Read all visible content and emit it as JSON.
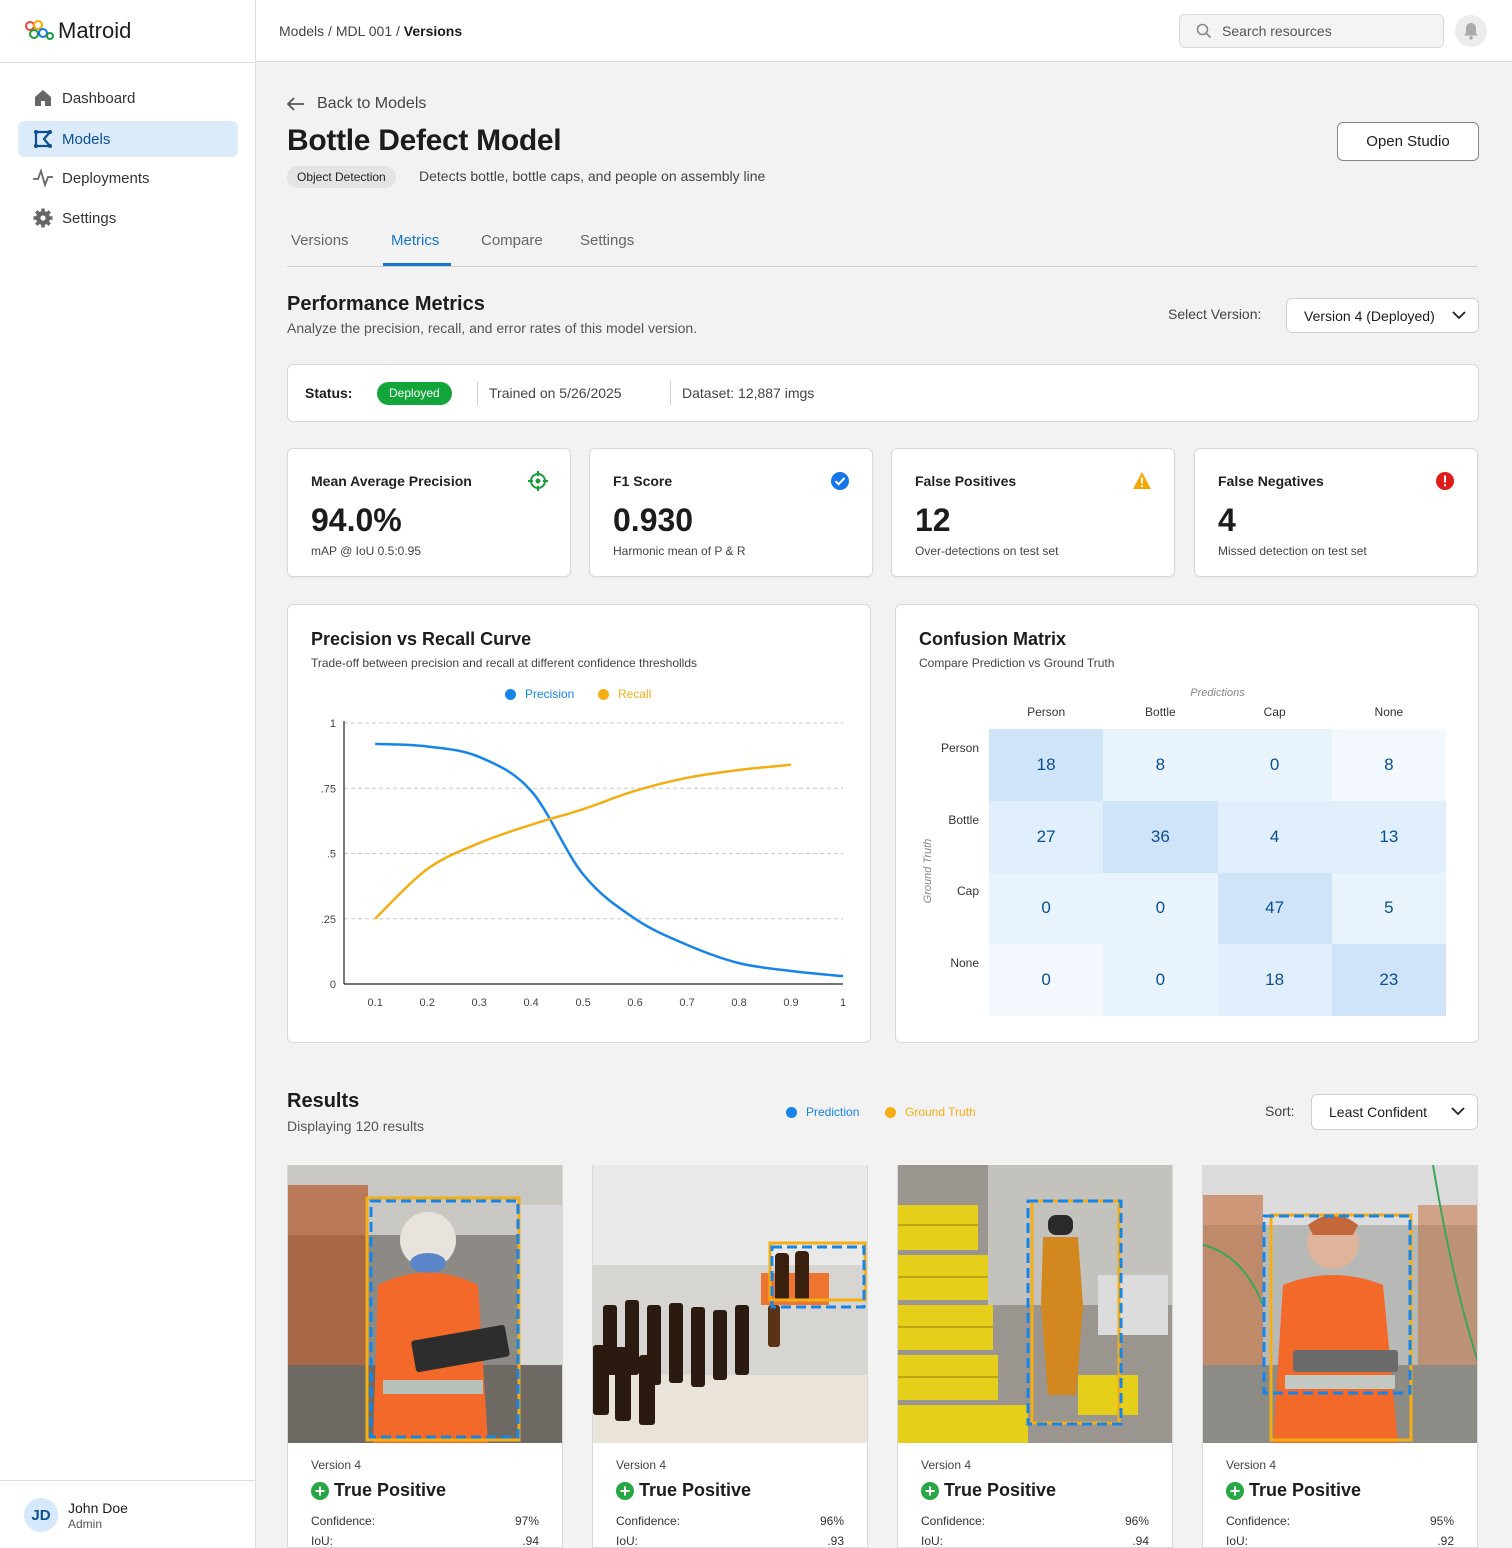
{
  "app": {
    "name": "Matroid"
  },
  "sidebar": {
    "items": [
      {
        "label": "Dashboard",
        "icon": "home-icon"
      },
      {
        "label": "Models",
        "icon": "models-icon",
        "active": true
      },
      {
        "label": "Deployments",
        "icon": "pulse-icon"
      },
      {
        "label": "Settings",
        "icon": "gear-icon"
      }
    ],
    "user": {
      "initials": "JD",
      "name": "John Doe",
      "role": "Admin"
    }
  },
  "header": {
    "breadcrumb": [
      "Models",
      "MDL 001",
      "Versions"
    ],
    "search_placeholder": "Search resources"
  },
  "page": {
    "back_label": "Back to Models",
    "title": "Bottle Defect Model",
    "type_chip": "Object Detection",
    "description": "Detects bottle, bottle caps, and people on assembly line",
    "open_studio_label": "Open Studio",
    "tabs": [
      "Versions",
      "Metrics",
      "Compare",
      "Settings"
    ],
    "active_tab": "Metrics"
  },
  "metrics": {
    "title": "Performance Metrics",
    "subtitle": "Analyze the precision, recall, and error rates of this model version.",
    "select_label": "Select Version:",
    "select_value": "Version 4 (Deployed)",
    "status_label": "Status:",
    "status_value": "Deployed",
    "trained": "Trained on 5/26/2025",
    "dataset": "Dataset: 12,887 imgs",
    "cards": [
      {
        "title": "Mean Average Precision",
        "value": "94.0%",
        "sub": "mAP @ IoU 0.5:0.95",
        "icon": "target-icon",
        "color": "#1a9e3c"
      },
      {
        "title": "F1 Score",
        "value": "0.930",
        "sub": "Harmonic mean of P & R",
        "icon": "check-circle-icon",
        "color": "#1677e8"
      },
      {
        "title": "False Positives",
        "value": "12",
        "sub": "Over-detections on test set",
        "icon": "warning-icon",
        "color": "#f5a800"
      },
      {
        "title": "False Negatives",
        "value": "4",
        "sub": "Missed detection on test set",
        "icon": "error-icon",
        "color": "#e01b1b"
      }
    ]
  },
  "pr_curve": {
    "title": "Precision vs Recall Curve",
    "subtitle": "Trade-off between precision and recall at different confidence threshollds",
    "chart_data": {
      "type": "line",
      "x": [
        0.1,
        0.2,
        0.3,
        0.4,
        0.5,
        0.6,
        0.7,
        0.8,
        0.9,
        1.0
      ],
      "xticks": [
        "0.1",
        "0.2",
        "0.3",
        "0.4",
        "0.5",
        "0.6",
        "0.7",
        "0.8",
        "0.9",
        "1"
      ],
      "yticks": [
        "0",
        ".25",
        ".5",
        ".75",
        "1"
      ],
      "ylim": [
        0,
        1
      ],
      "xlim": [
        0.04,
        1.0
      ],
      "grid": "horizontal dashed",
      "legend_position": "top-center",
      "series": [
        {
          "name": "Precision",
          "color": "#1684e8",
          "values": [
            0.92,
            0.91,
            0.87,
            0.74,
            0.42,
            0.25,
            0.15,
            0.08,
            0.05,
            0.03
          ]
        },
        {
          "name": "Recall",
          "color": "#f4ae14",
          "values": [
            0.25,
            0.44,
            0.54,
            0.61,
            0.67,
            0.74,
            0.79,
            0.82,
            0.84,
            0.85
          ]
        }
      ]
    }
  },
  "confusion": {
    "title": "Confusion Matrix",
    "subtitle": "Compare Prediction vs Ground Truth",
    "x_axis_label": "Predictions",
    "y_axis_label": "Ground Truth",
    "chart_data": {
      "type": "heatmap",
      "columns": [
        "Person",
        "Bottle",
        "Cap",
        "None"
      ],
      "rows": [
        "Person",
        "Bottle",
        "Cap",
        "None"
      ],
      "values": [
        [
          18,
          8,
          0,
          8
        ],
        [
          27,
          36,
          4,
          13
        ],
        [
          0,
          0,
          47,
          5
        ],
        [
          0,
          0,
          18,
          23
        ]
      ],
      "colors": [
        [
          "#cfe4f8",
          "#e9f3fc",
          "#e9f3fc",
          "#f2f8fe"
        ],
        [
          "#e1eefb",
          "#cfe4f8",
          "#e1eefb",
          "#e1eefb"
        ],
        [
          "#e9f3fc",
          "#e9f3fc",
          "#cfe4f8",
          "#e9f3fc"
        ],
        [
          "#f2f8fe",
          "#e9f3fc",
          "#e1eefb",
          "#cfe4f8"
        ]
      ],
      "value_color": "#0b4e92"
    }
  },
  "results": {
    "title": "Results",
    "subtitle": "Displaying 120 results",
    "legend": [
      {
        "name": "Prediction",
        "color": "#1684e8"
      },
      {
        "name": "Ground Truth",
        "color": "#f4ae14"
      }
    ],
    "sort_label": "Sort:",
    "sort_value": "Least Confident",
    "confidence_label": "Confidence:",
    "iou_label": "IoU:",
    "items": [
      {
        "version": "Version 4",
        "status": "True Positive",
        "confidence": "97%",
        "iou": ".94"
      },
      {
        "version": "Version 4",
        "status": "True Positive",
        "confidence": "96%",
        "iou": ".93"
      },
      {
        "version": "Version 4",
        "status": "True Positive",
        "confidence": "96%",
        "iou": ".94"
      },
      {
        "version": "Version 4",
        "status": "True Positive",
        "confidence": "95%",
        "iou": ".92"
      }
    ]
  }
}
